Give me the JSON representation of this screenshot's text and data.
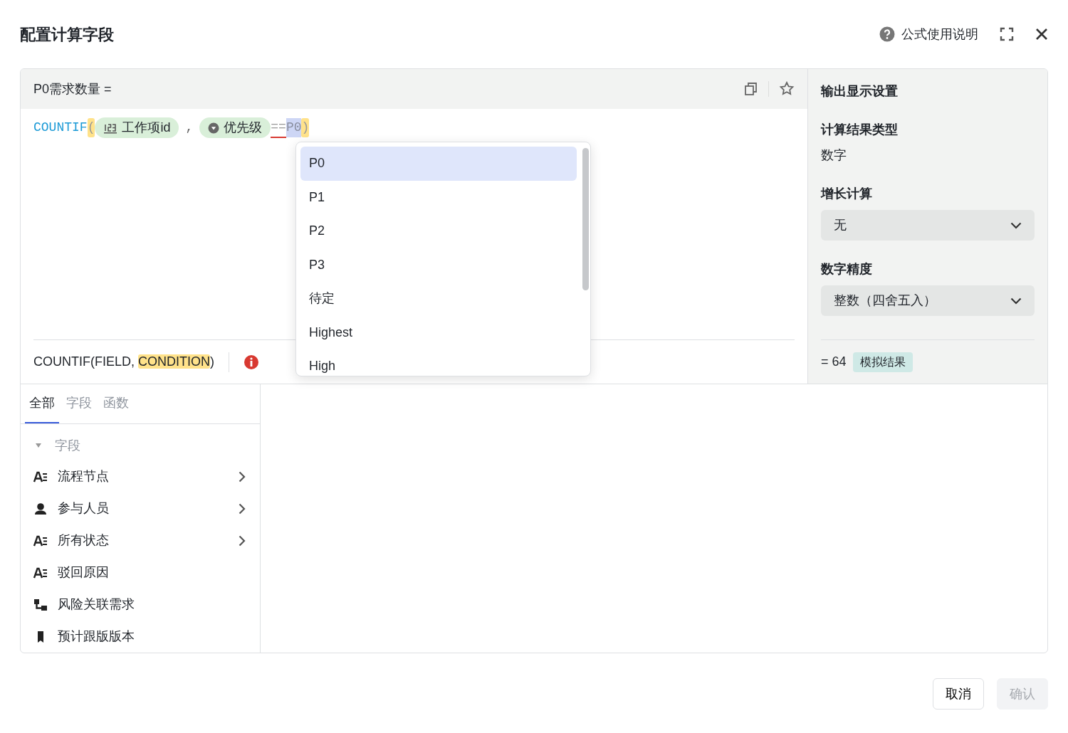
{
  "dialog": {
    "title": "配置计算字段",
    "help_link": "公式使用说明"
  },
  "formula": {
    "name": "P0需求数量 =",
    "tokens": [
      {
        "kind": "function",
        "text": "COUNTIF"
      },
      {
        "kind": "paren",
        "text": "("
      },
      {
        "kind": "number-field",
        "text": "工作项id"
      },
      {
        "kind": "operator",
        "text": ","
      },
      {
        "kind": "select-field",
        "text": "优先级"
      },
      {
        "kind": "error",
        "text": "=="
      },
      {
        "kind": "selection",
        "text": "P0"
      },
      {
        "kind": "paren",
        "text": ")"
      }
    ],
    "signature": [
      {
        "text": "COUNTIF(FIELD, ",
        "highlighted": false
      },
      {
        "text": "CONDITION",
        "highlighted": true
      },
      {
        "text": ")",
        "highlighted": false
      }
    ]
  },
  "suggestions": [
    {
      "label": "P0",
      "selected": true
    },
    {
      "label": "P1",
      "selected": false
    },
    {
      "label": "P2",
      "selected": false
    },
    {
      "label": "P3",
      "selected": false
    },
    {
      "label": "待定",
      "selected": false
    },
    {
      "label": "Highest",
      "selected": false
    },
    {
      "label": "High",
      "selected": false
    }
  ],
  "output": {
    "title": "输出显示设置",
    "result_type_label": "计算结果类型",
    "result_type": "数字",
    "growth_label": "增长计算",
    "growth_value": "无",
    "precision_label": "数字精度",
    "precision_value": "整数（四舍五入）",
    "result": "= 64",
    "result_badge": "模拟结果"
  },
  "sidebar": {
    "tabs": [
      {
        "label": "全部",
        "selected": true
      },
      {
        "label": "字段",
        "selected": false
      },
      {
        "label": "函数",
        "selected": false
      }
    ],
    "group": {
      "label": "字段",
      "expanded": true,
      "items": [
        {
          "label": "流程节点",
          "kind": "text",
          "has_children": true
        },
        {
          "label": "参与人员",
          "kind": "person",
          "has_children": true
        },
        {
          "label": "所有状态",
          "kind": "text",
          "has_children": true
        },
        {
          "label": "驳回原因",
          "kind": "text",
          "has_children": false
        },
        {
          "label": "风险关联需求",
          "kind": "relation",
          "has_children": false
        },
        {
          "label": "预计跟版版本",
          "kind": "version",
          "has_children": false
        }
      ]
    }
  },
  "footer": [
    {
      "label": "取消",
      "disabled": false
    },
    {
      "label": "确认",
      "disabled": true
    }
  ]
}
